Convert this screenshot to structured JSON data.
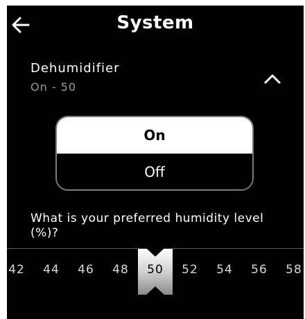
{
  "header": {
    "title": "System",
    "back_icon": "arrow-left-icon"
  },
  "section": {
    "title": "Dehumidifier",
    "subtitle": "On - 50",
    "expand_icon": "chevron-up-icon"
  },
  "toggle": {
    "options": [
      "On",
      "Off"
    ],
    "selected": "On"
  },
  "humidity": {
    "question": "What is your preferred humidity level (%)?",
    "ticks": [
      "42",
      "44",
      "46",
      "48",
      "50",
      "52",
      "54",
      "56",
      "58"
    ],
    "selected": "50"
  },
  "colors": {
    "background": "#000000",
    "text": "#ffffff",
    "secondary_text": "#9a9a9a",
    "border": "#7c7c7c"
  }
}
